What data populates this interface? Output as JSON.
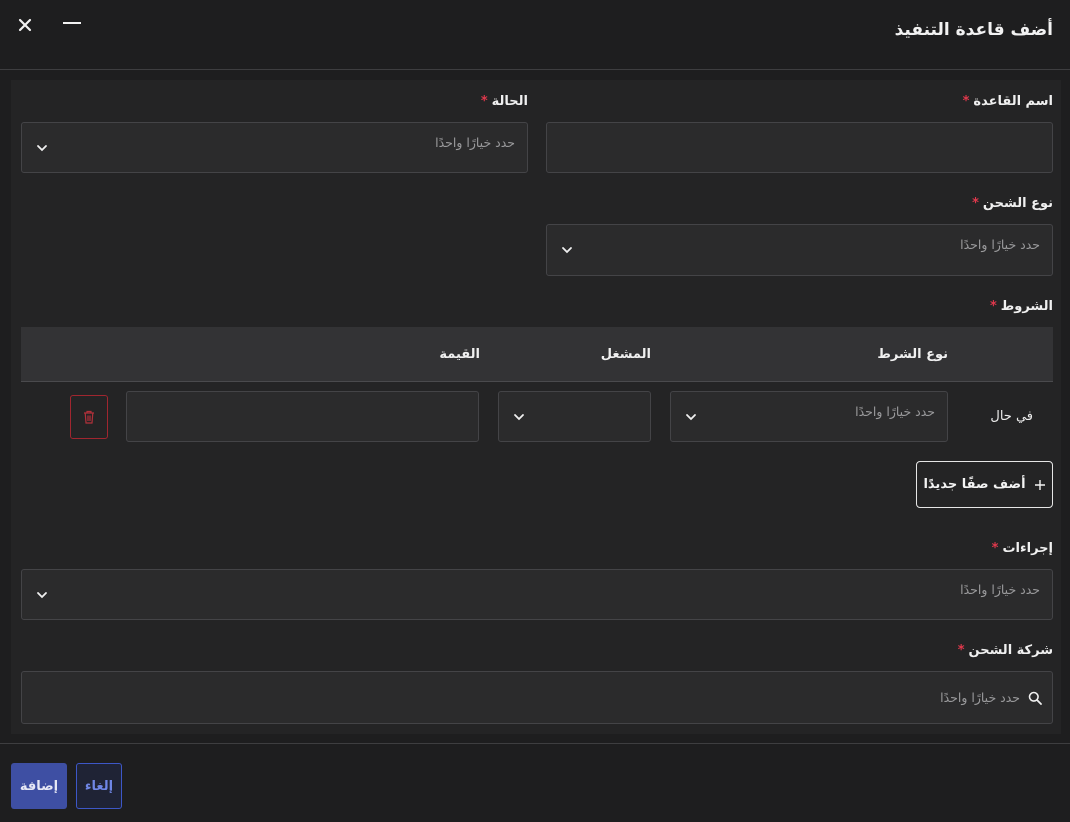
{
  "header": {
    "title": "أضف قاعدة التنفيذ",
    "close_icon": "close-icon",
    "minimize_icon": "minimize-icon"
  },
  "form": {
    "required_mark": "*",
    "rule_name": {
      "label": "اسم القاعدة",
      "value": ""
    },
    "status": {
      "label": "الحالة",
      "placeholder": "حدد خيارًا واحدًا"
    },
    "shipping_type": {
      "label": "نوع الشحن",
      "placeholder": "حدد خيارًا واحدًا"
    },
    "conditions": {
      "label": "الشروط",
      "columns": [
        "نوع الشرط",
        "المشغل",
        "القيمة"
      ],
      "rows": [
        {
          "prefix": "في حال",
          "condition_type_placeholder": "حدد خيارًا واحدًا",
          "operator": "",
          "value": ""
        }
      ],
      "add_row_label": "أضف صفًا جديدًا"
    },
    "actions": {
      "label": "إجراءات",
      "placeholder": "حدد خيارًا واحدًا"
    },
    "shipping_company": {
      "label": "شركة الشحن",
      "placeholder": "حدد خيارًا واحدًا"
    }
  },
  "footer": {
    "add_label": "إضافة",
    "cancel_label": "إلغاء"
  },
  "colors": {
    "background": "#1e1e1f",
    "required": "#e0384c",
    "primary": "#3e4fa3",
    "danger": "#a0262f"
  }
}
